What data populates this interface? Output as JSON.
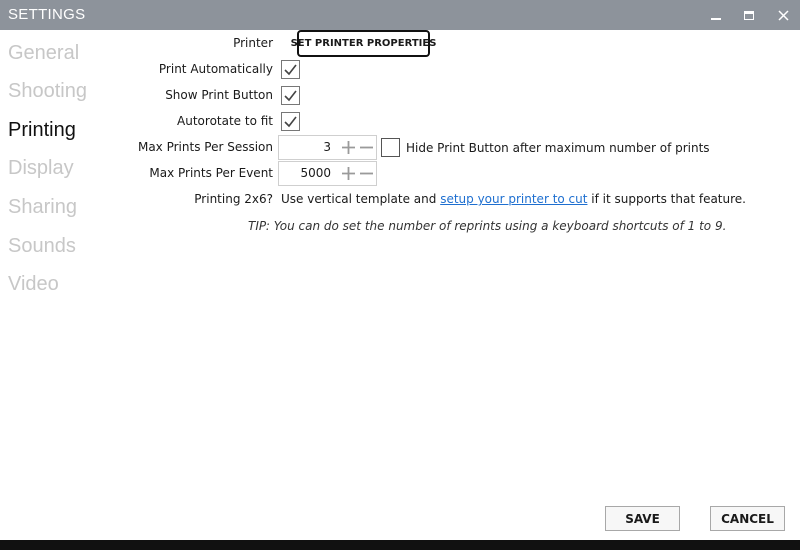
{
  "window": {
    "title": "SETTINGS"
  },
  "sidebar": {
    "items": [
      {
        "label": "General",
        "active": false
      },
      {
        "label": "Shooting",
        "active": false
      },
      {
        "label": "Printing",
        "active": true
      },
      {
        "label": "Display",
        "active": false
      },
      {
        "label": "Sharing",
        "active": false
      },
      {
        "label": "Sounds",
        "active": false
      },
      {
        "label": "Video",
        "active": false
      }
    ]
  },
  "printing": {
    "printer_label": "Printer",
    "printer_button": "SET PRINTER PROPERTIES",
    "print_automatically": {
      "label": "Print Automatically",
      "checked": true
    },
    "show_print_button": {
      "label": "Show Print Button",
      "checked": true
    },
    "autorotate": {
      "label": "Autorotate to fit",
      "checked": true
    },
    "max_session": {
      "label": "Max Prints Per Session",
      "value": "3"
    },
    "hide_print_button": {
      "label": "Hide Print Button after maximum number of prints",
      "checked": false
    },
    "max_event": {
      "label": "Max Prints Per Event",
      "value": "5000"
    },
    "printing_2x6": {
      "label": "Printing 2x6?",
      "text_before": "Use vertical template and",
      "link": "setup your printer to cut",
      "text_after": "if it supports that feature."
    },
    "tip": "TIP: You can do set the number of reprints using a keyboard shortcuts of 1 to 9."
  },
  "footer": {
    "save": "SAVE",
    "cancel": "CANCEL"
  },
  "colors": {
    "titlebar": "#8d939b",
    "link": "#1e6fd0",
    "inactive_nav": "#c7c7c7"
  }
}
